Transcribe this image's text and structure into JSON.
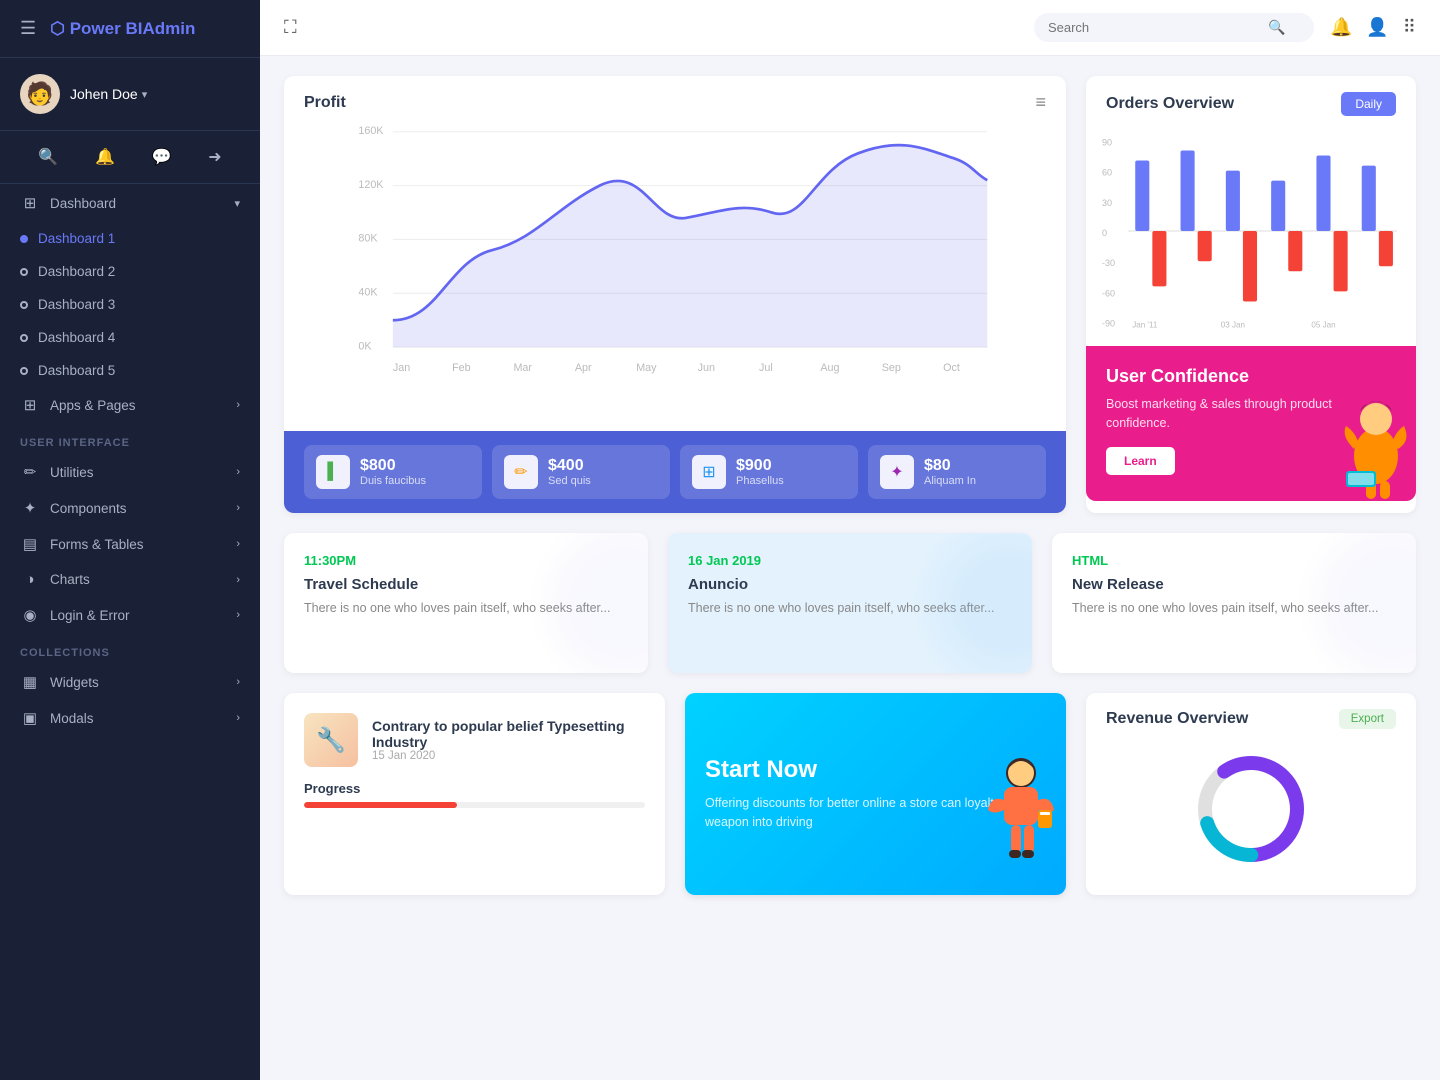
{
  "app": {
    "name": "Power BI",
    "name_highlight": "Admin",
    "logo_icon": "⬡"
  },
  "user": {
    "name": "Johen Doe",
    "avatar_emoji": "🧑"
  },
  "topbar": {
    "search_placeholder": "Search",
    "expand_icon": "⛶",
    "search_icon": "🔍",
    "bell_icon": "🔔",
    "user_icon": "👤",
    "apps_icon": "⠿"
  },
  "sidebar": {
    "hamburger": "☰",
    "icons": [
      "🔍",
      "🔔",
      "💬",
      "➜"
    ],
    "dashboard_label": "Dashboard",
    "items": [
      {
        "label": "Dashboard 1",
        "active": true
      },
      {
        "label": "Dashboard 2",
        "active": false
      },
      {
        "label": "Dashboard 3",
        "active": false
      },
      {
        "label": "Dashboard 4",
        "active": false
      },
      {
        "label": "Dashboard 5",
        "active": false
      }
    ],
    "apps_pages": "Apps & Pages",
    "section_ui": "USER INTERFACE",
    "utilities": "Utilities",
    "components": "Components",
    "forms_tables": "Forms & Tables",
    "charts": "Charts",
    "login_error": "Login & Error",
    "section_collections": "COLLECTIONS",
    "widgets": "Widgets",
    "modals": "Modals"
  },
  "profit": {
    "title": "Profit",
    "menu_icon": "≡",
    "y_labels": [
      "160K",
      "120K",
      "80K",
      "40K",
      "0K"
    ],
    "x_labels": [
      "Jan",
      "Feb",
      "Mar",
      "Apr",
      "May",
      "Jun",
      "Jul",
      "Aug",
      "Sep",
      "Oct"
    ],
    "stats": [
      {
        "value": "$800",
        "label": "Duis faucibus",
        "icon": "▌",
        "color": "#4caf50"
      },
      {
        "value": "$400",
        "label": "Sed quis",
        "icon": "✏",
        "color": "#ff9800"
      },
      {
        "value": "$900",
        "label": "Phasellus",
        "icon": "⊞",
        "color": "#2196f3"
      },
      {
        "value": "$80",
        "label": "Aliquam In",
        "icon": "✦",
        "color": "#9c27b0"
      }
    ]
  },
  "orders": {
    "title": "Orders Overview",
    "btn_label": "Daily",
    "y_labels": [
      "90",
      "60",
      "30",
      "0",
      "-30",
      "-60",
      "-90"
    ],
    "x_labels": [
      "Jan '11",
      "03 Jan",
      "05 Jan"
    ],
    "confidence": {
      "title": "User Confidence",
      "desc": "Boost marketing & sales through product confidence.",
      "btn_label": "Learn"
    }
  },
  "cards": [
    {
      "time": "11:30PM",
      "title": "Travel Schedule",
      "text": "There is no one who loves pain itself, who seeks after...",
      "bg": "white"
    },
    {
      "time": "16 Jan 2019",
      "title": "Anuncio",
      "text": "There is no one who loves pain itself, who seeks after...",
      "bg": "light-blue"
    },
    {
      "time": "HTML",
      "title": "New Release",
      "text": "There is no one who loves pain itself, who seeks after...",
      "bg": "white"
    }
  ],
  "blog": {
    "title": "Contrary to popular belief Typesetting Industry",
    "date": "15 Jan 2020",
    "progress_label": "Progress",
    "progress_value": 45
  },
  "start_now": {
    "title": "Start Now",
    "text": "Offering discounts for better online a store can loyalty weapon into driving"
  },
  "revenue": {
    "title": "Revenue Overview",
    "btn_label": "Export",
    "donut_segments": [
      {
        "value": 60,
        "color": "#7c3aed"
      },
      {
        "value": 40,
        "color": "#e0e0e0"
      }
    ]
  }
}
